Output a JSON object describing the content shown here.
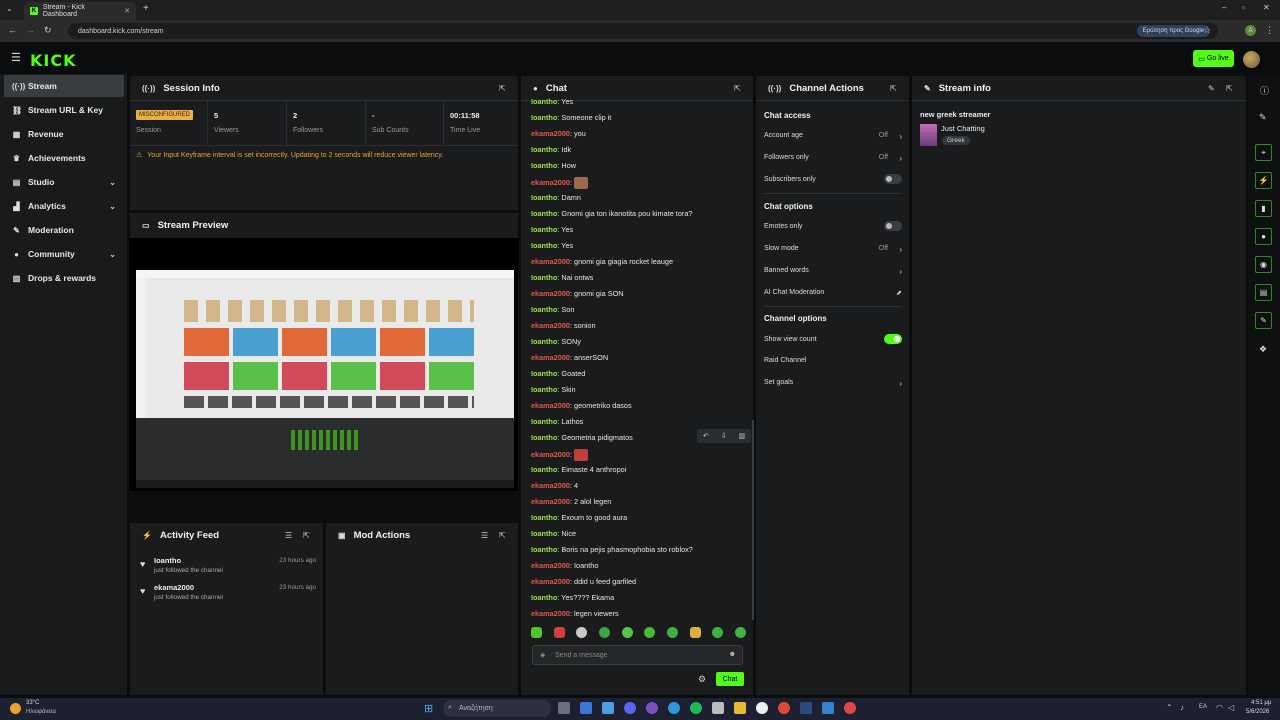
{
  "browser": {
    "tab_title": "Stream - Kick Dashboard",
    "url": "dashboard.kick.com/stream",
    "search_chip": "Ερώτηση προς Google",
    "profile_initial": "A"
  },
  "header": {
    "logo": "KICK",
    "go_live": "Go live"
  },
  "sidebar": {
    "items": [
      {
        "label": "Stream",
        "icon": "stream-icon"
      },
      {
        "label": "Stream URL & Key",
        "icon": "link-icon"
      },
      {
        "label": "Revenue",
        "icon": "revenue-icon"
      },
      {
        "label": "Achievements",
        "icon": "trophy-icon"
      },
      {
        "label": "Studio",
        "icon": "studio-icon"
      },
      {
        "label": "Analytics",
        "icon": "analytics-icon"
      },
      {
        "label": "Moderation",
        "icon": "wrench-icon"
      },
      {
        "label": "Community",
        "icon": "community-icon"
      },
      {
        "label": "Drops & rewards",
        "icon": "gift-icon"
      }
    ]
  },
  "session": {
    "title": "Session Info",
    "status_badge": "MISCONFIGURED",
    "cells": [
      {
        "value": "",
        "label": "Session"
      },
      {
        "value": "5",
        "label": "Viewers"
      },
      {
        "value": "2",
        "label": "Followers"
      },
      {
        "value": "-",
        "label": "Sub Counts"
      },
      {
        "value": "00:11:58",
        "label": "Time Live"
      }
    ],
    "warning": "Your Input Keyframe interval is set incorrectly. Updating to 2 seconds will reduce viewer latency."
  },
  "preview": {
    "title": "Stream Preview"
  },
  "activity": {
    "title": "Activity Feed",
    "items": [
      {
        "name": "Ioantho",
        "sub": "just followed the channel",
        "time": "23 hours ago"
      },
      {
        "name": "ekama2000",
        "sub": "just followed the channel",
        "time": "23 hours ago"
      }
    ]
  },
  "mod_actions": {
    "title": "Mod Actions"
  },
  "chat": {
    "title": "Chat",
    "messages": [
      {
        "user": "Ioantho",
        "text": "Yes"
      },
      {
        "user": "Ioantho",
        "text": "Someone clip it"
      },
      {
        "user": "ekama2000",
        "text": "you"
      },
      {
        "user": "Ioantho",
        "text": "Idk"
      },
      {
        "user": "Ioantho",
        "text": "How"
      },
      {
        "user": "ekama2000",
        "text": ""
      },
      {
        "user": "Ioantho",
        "text": "Damn"
      },
      {
        "user": "Ioantho",
        "text": "Gnomi gia ton ikanotita pou kimate tora?"
      },
      {
        "user": "Ioantho",
        "text": "Yes"
      },
      {
        "user": "Ioantho",
        "text": "Yes"
      },
      {
        "user": "ekama2000",
        "text": "gnomi gia giagia rocket leauge"
      },
      {
        "user": "Ioantho",
        "text": "Nai ontws"
      },
      {
        "user": "ekama2000",
        "text": "gnomi gia SON"
      },
      {
        "user": "Ioantho",
        "text": "Son"
      },
      {
        "user": "ekama2000",
        "text": "sonion"
      },
      {
        "user": "Ioantho",
        "text": "SONy"
      },
      {
        "user": "ekama2000",
        "text": "anserSON"
      },
      {
        "user": "Ioantho",
        "text": "Goated"
      },
      {
        "user": "Ioantho",
        "text": "Skin"
      },
      {
        "user": "ekama2000",
        "text": "geometriko dasos"
      },
      {
        "user": "Ioantho",
        "text": "Lathos"
      },
      {
        "user": "Ioantho",
        "text": "Geometria pidigmatos"
      },
      {
        "user": "ekama2000",
        "text": ""
      },
      {
        "user": "Ioantho",
        "text": "Eimaste 4 anthropoi"
      },
      {
        "user": "ekama2000",
        "text": "4"
      },
      {
        "user": "ekama2000",
        "text": "2 alol legen"
      },
      {
        "user": "Ioantho",
        "text": "Exoum to good aura"
      },
      {
        "user": "Ioantho",
        "text": "Nice"
      },
      {
        "user": "Ioantho",
        "text": "Boris na pejis phasmophobia sto roblox?"
      },
      {
        "user": "ekama2000",
        "text": "Ioantho"
      },
      {
        "user": "ekama2000",
        "text": "ddid u feed garfiled"
      },
      {
        "user": "Ioantho",
        "text": "Yes???? Ekama"
      },
      {
        "user": "ekama2000",
        "text": "legen viewers"
      }
    ],
    "input_placeholder": "Send a message",
    "send_label": "Chat"
  },
  "channel_actions": {
    "title": "Channel Actions",
    "chat_access_heading": "Chat access",
    "account_age": {
      "label": "Account age",
      "value": "Off"
    },
    "followers_only": {
      "label": "Followers only",
      "value": "Off"
    },
    "subscribers_only": {
      "label": "Subscribers only",
      "on": false
    },
    "chat_options_heading": "Chat options",
    "emotes_only": {
      "label": "Emotes only",
      "on": false
    },
    "slow_mode": {
      "label": "Slow mode",
      "value": "Off"
    },
    "banned_words": {
      "label": "Banned words"
    },
    "ai_moderation": {
      "label": "AI Chat Moderation"
    },
    "channel_options_heading": "Channel options",
    "show_view_count": {
      "label": "Show view count",
      "on": true
    },
    "raid_channel": {
      "label": "Raid Channel"
    },
    "set_goals": {
      "label": "Set goals"
    }
  },
  "stream_info": {
    "title": "Stream info",
    "stream_title": "new greek streamer",
    "category": "Just Chatting",
    "tag": "Greek"
  },
  "taskbar": {
    "weather_temp": "33°C",
    "weather_desc": "Ηλιοφάνεια",
    "search": "Αναζήτηση",
    "lang": "EA",
    "time": "4:51 μμ",
    "date": "5/6/2026"
  },
  "colors": {
    "accent": "#53fc18",
    "user_a": "#9fe04a",
    "user_b": "#e0584a",
    "warning": "#e8a33a"
  }
}
